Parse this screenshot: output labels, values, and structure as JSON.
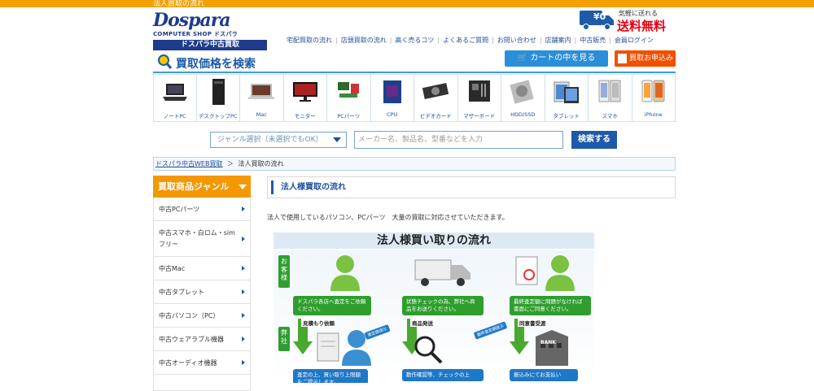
{
  "header": {
    "topbar_text": "法人買取の流れ",
    "logo": {
      "main": "Dospara",
      "sub": "COMPUTER SHOP ドスパラ",
      "band": "ドスパラ中古買取"
    },
    "free_shipping": {
      "small": "気軽に送れる",
      "big": "送料無料",
      "badge": "¥0"
    },
    "nav": [
      "宅配買取の流れ",
      "店頭買取の流れ",
      "高く売るコツ",
      "よくあるご質問",
      "お問い合わせ",
      "店舗案内",
      "中古販売",
      "会員ログイン"
    ],
    "search_title": "買取価格を検索",
    "cart_button": "カートの中を見る",
    "apply_button": "買取お申込み"
  },
  "categories": [
    {
      "label": "ノートPC",
      "icon": "laptop-icon"
    },
    {
      "label": "デスクトップPC",
      "icon": "desktop-tower-icon"
    },
    {
      "label": "Mac",
      "icon": "mac-icon"
    },
    {
      "label": "モニター",
      "icon": "monitor-icon"
    },
    {
      "label": "PCパーツ",
      "icon": "pc-parts-icon"
    },
    {
      "label": "CPU",
      "icon": "cpu-icon"
    },
    {
      "label": "ビデオカード",
      "icon": "video-card-icon"
    },
    {
      "label": "マザーボード",
      "icon": "motherboard-icon"
    },
    {
      "label": "HDD/SSD",
      "icon": "hdd-icon"
    },
    {
      "label": "タブレット",
      "icon": "tablet-icon"
    },
    {
      "label": "スマホ",
      "icon": "smartphone-icon"
    },
    {
      "label": "iPhone",
      "icon": "iphone-icon"
    }
  ],
  "search": {
    "genre_select": "ジャンル選択（未選択でもOK）",
    "keyword_placeholder": "メーカー名、製品名、型番などを入力",
    "button": "検索する"
  },
  "breadcrumb": {
    "home": "ドスパラ中古WEB買取",
    "separator": "＞",
    "current": "法人買取の流れ"
  },
  "sidebar": {
    "title": "買取商品ジャンル",
    "items": [
      "中古PCパーツ",
      "中古スマホ・白ロム・simフリー",
      "中古Mac",
      "中古タブレット",
      "中古パソコン（PC）",
      "中古ウェアラブル機器",
      "中古オーディオ機器"
    ]
  },
  "main": {
    "title": "法人様買取の流れ",
    "intro": "法人で使用しているパソコン、PCパーツ　大量の買取に対応させていただきます。"
  },
  "flow": {
    "title": "法人様買い取りの流れ",
    "tag_customer": "お客様",
    "tag_company": "弊社",
    "step1_box": "ドスパラ各店へ査定をご依頼ください。",
    "step1_label": "見積もり依頼",
    "step2_box": "状態チェックの為、弊社へ商品をお送りください。",
    "step2_label": "商品発送",
    "step3_box": "最終査定額に問題がなければ書面にご同意ください。",
    "step3_label": "同意書受渡",
    "ticket1": "査定額提示",
    "ticket2": "最終査定額提示",
    "company1_box": "査定の上、買い取り上限額をご提示します。",
    "company2_box": "動作確認等、チェックの上",
    "company3_box": "振込みにてお支払い",
    "bank_label": "BANK"
  },
  "colors": {
    "orange": "#f3a000",
    "blue": "#1e5aa8",
    "red": "#e60012",
    "green": "#2f9e2f",
    "apply": "#f25000"
  }
}
